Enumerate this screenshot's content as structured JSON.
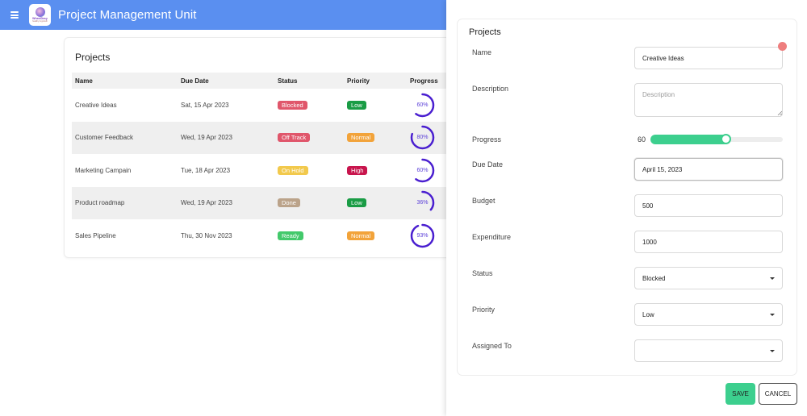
{
  "header": {
    "title": "Project Management Unit",
    "logo_text": "WheelDesy",
    "logo_sub": "healthy & growth"
  },
  "projects": {
    "title": "Projects",
    "columns": [
      "Name",
      "Due Date",
      "Status",
      "Priority",
      "Progress"
    ],
    "rows": [
      {
        "name": "Creative Ideas",
        "due": "Sat, 15 Apr 2023",
        "status": "Blocked",
        "status_color": "#e0566b",
        "priority": "Low",
        "priority_color": "#1a9c45",
        "progress": 60,
        "progress_label": "60%"
      },
      {
        "name": "Customer Feedback",
        "due": "Wed, 19 Apr 2023",
        "status": "Off Track",
        "status_color": "#e0566b",
        "priority": "Normal",
        "priority_color": "#f2a33a",
        "progress": 80,
        "progress_label": "80%"
      },
      {
        "name": "Marketing Campain",
        "due": "Tue, 18 Apr 2023",
        "status": "On Hold",
        "status_color": "#f2c94c",
        "priority": "High",
        "priority_color": "#c8154d",
        "progress": 60,
        "progress_label": "60%"
      },
      {
        "name": "Product roadmap",
        "due": "Wed, 19 Apr 2023",
        "status": "Done",
        "status_color": "#bba38a",
        "priority": "Low",
        "priority_color": "#1a9c45",
        "progress": 36,
        "progress_label": "36%"
      },
      {
        "name": "Sales Pipeline",
        "due": "Thu, 30 Nov 2023",
        "status": "Ready",
        "status_color": "#43c96b",
        "priority": "Normal",
        "priority_color": "#f2a33a",
        "progress": 93,
        "progress_label": "93%"
      }
    ]
  },
  "form": {
    "title": "Projects",
    "name_label": "Name",
    "name_value": "Creative Ideas",
    "description_label": "Description",
    "description_placeholder": "Description",
    "progress_label": "Progress",
    "progress_value": "60",
    "progress_fraction": 0.6,
    "due_label": "Due Date",
    "due_value": "April 15, 2023",
    "budget_label": "Budget",
    "budget_value": "500",
    "expenditure_label": "Expenditure",
    "expenditure_value": "1000",
    "status_label": "Status",
    "status_value": "Blocked",
    "priority_label": "Priority",
    "priority_value": "Low",
    "assigned_label": "Assigned To",
    "assigned_value": "",
    "save_label": "SAVE",
    "cancel_label": "CANCEL"
  },
  "colors": {
    "header": "#5a8ff0",
    "accent_green": "#3ccf8e",
    "progress_ring": "#4a1fd0"
  }
}
